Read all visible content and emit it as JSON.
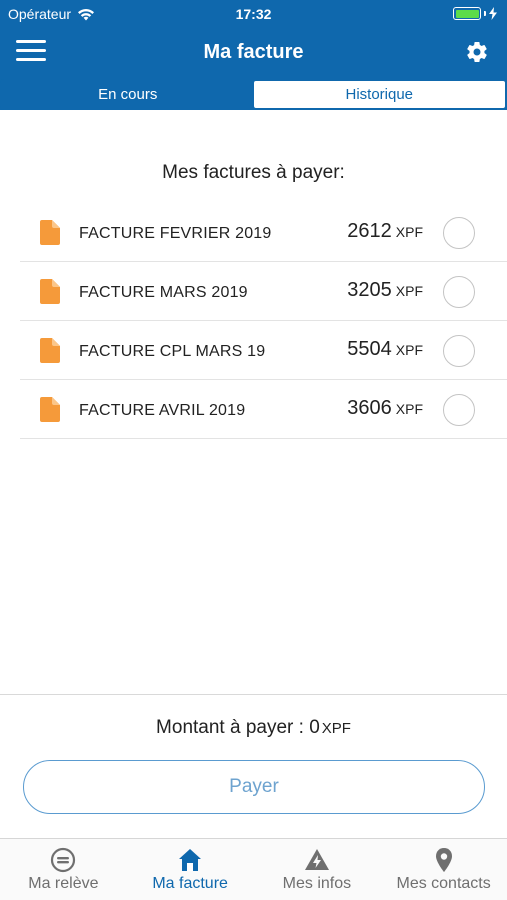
{
  "status_bar": {
    "carrier": "Opérateur",
    "time": "17:32"
  },
  "navbar": {
    "title": "Ma facture"
  },
  "segments": {
    "current": "En cours",
    "history": "Historique"
  },
  "section_title": "Mes factures à payer:",
  "invoices": [
    {
      "label": "FACTURE FEVRIER 2019",
      "amount": "2612",
      "currency": "XPF"
    },
    {
      "label": "FACTURE MARS 2019",
      "amount": "3205",
      "currency": "XPF"
    },
    {
      "label": "FACTURE CPL MARS 19",
      "amount": "5504",
      "currency": "XPF"
    },
    {
      "label": "FACTURE AVRIL 2019",
      "amount": "3606",
      "currency": "XPF"
    }
  ],
  "total": {
    "label": "Montant à payer : 0",
    "currency": "XPF"
  },
  "pay_button": "Payer",
  "tabs": [
    {
      "label": "Ma relève",
      "icon": "meter-icon"
    },
    {
      "label": "Ma facture",
      "icon": "home-icon"
    },
    {
      "label": "Mes infos",
      "icon": "warning-icon"
    },
    {
      "label": "Mes contacts",
      "icon": "location-pin-icon"
    }
  ],
  "colors": {
    "brand_blue": "#0f68ad",
    "document_orange": "#f59a3a",
    "battery_green": "#5ddc4a"
  }
}
